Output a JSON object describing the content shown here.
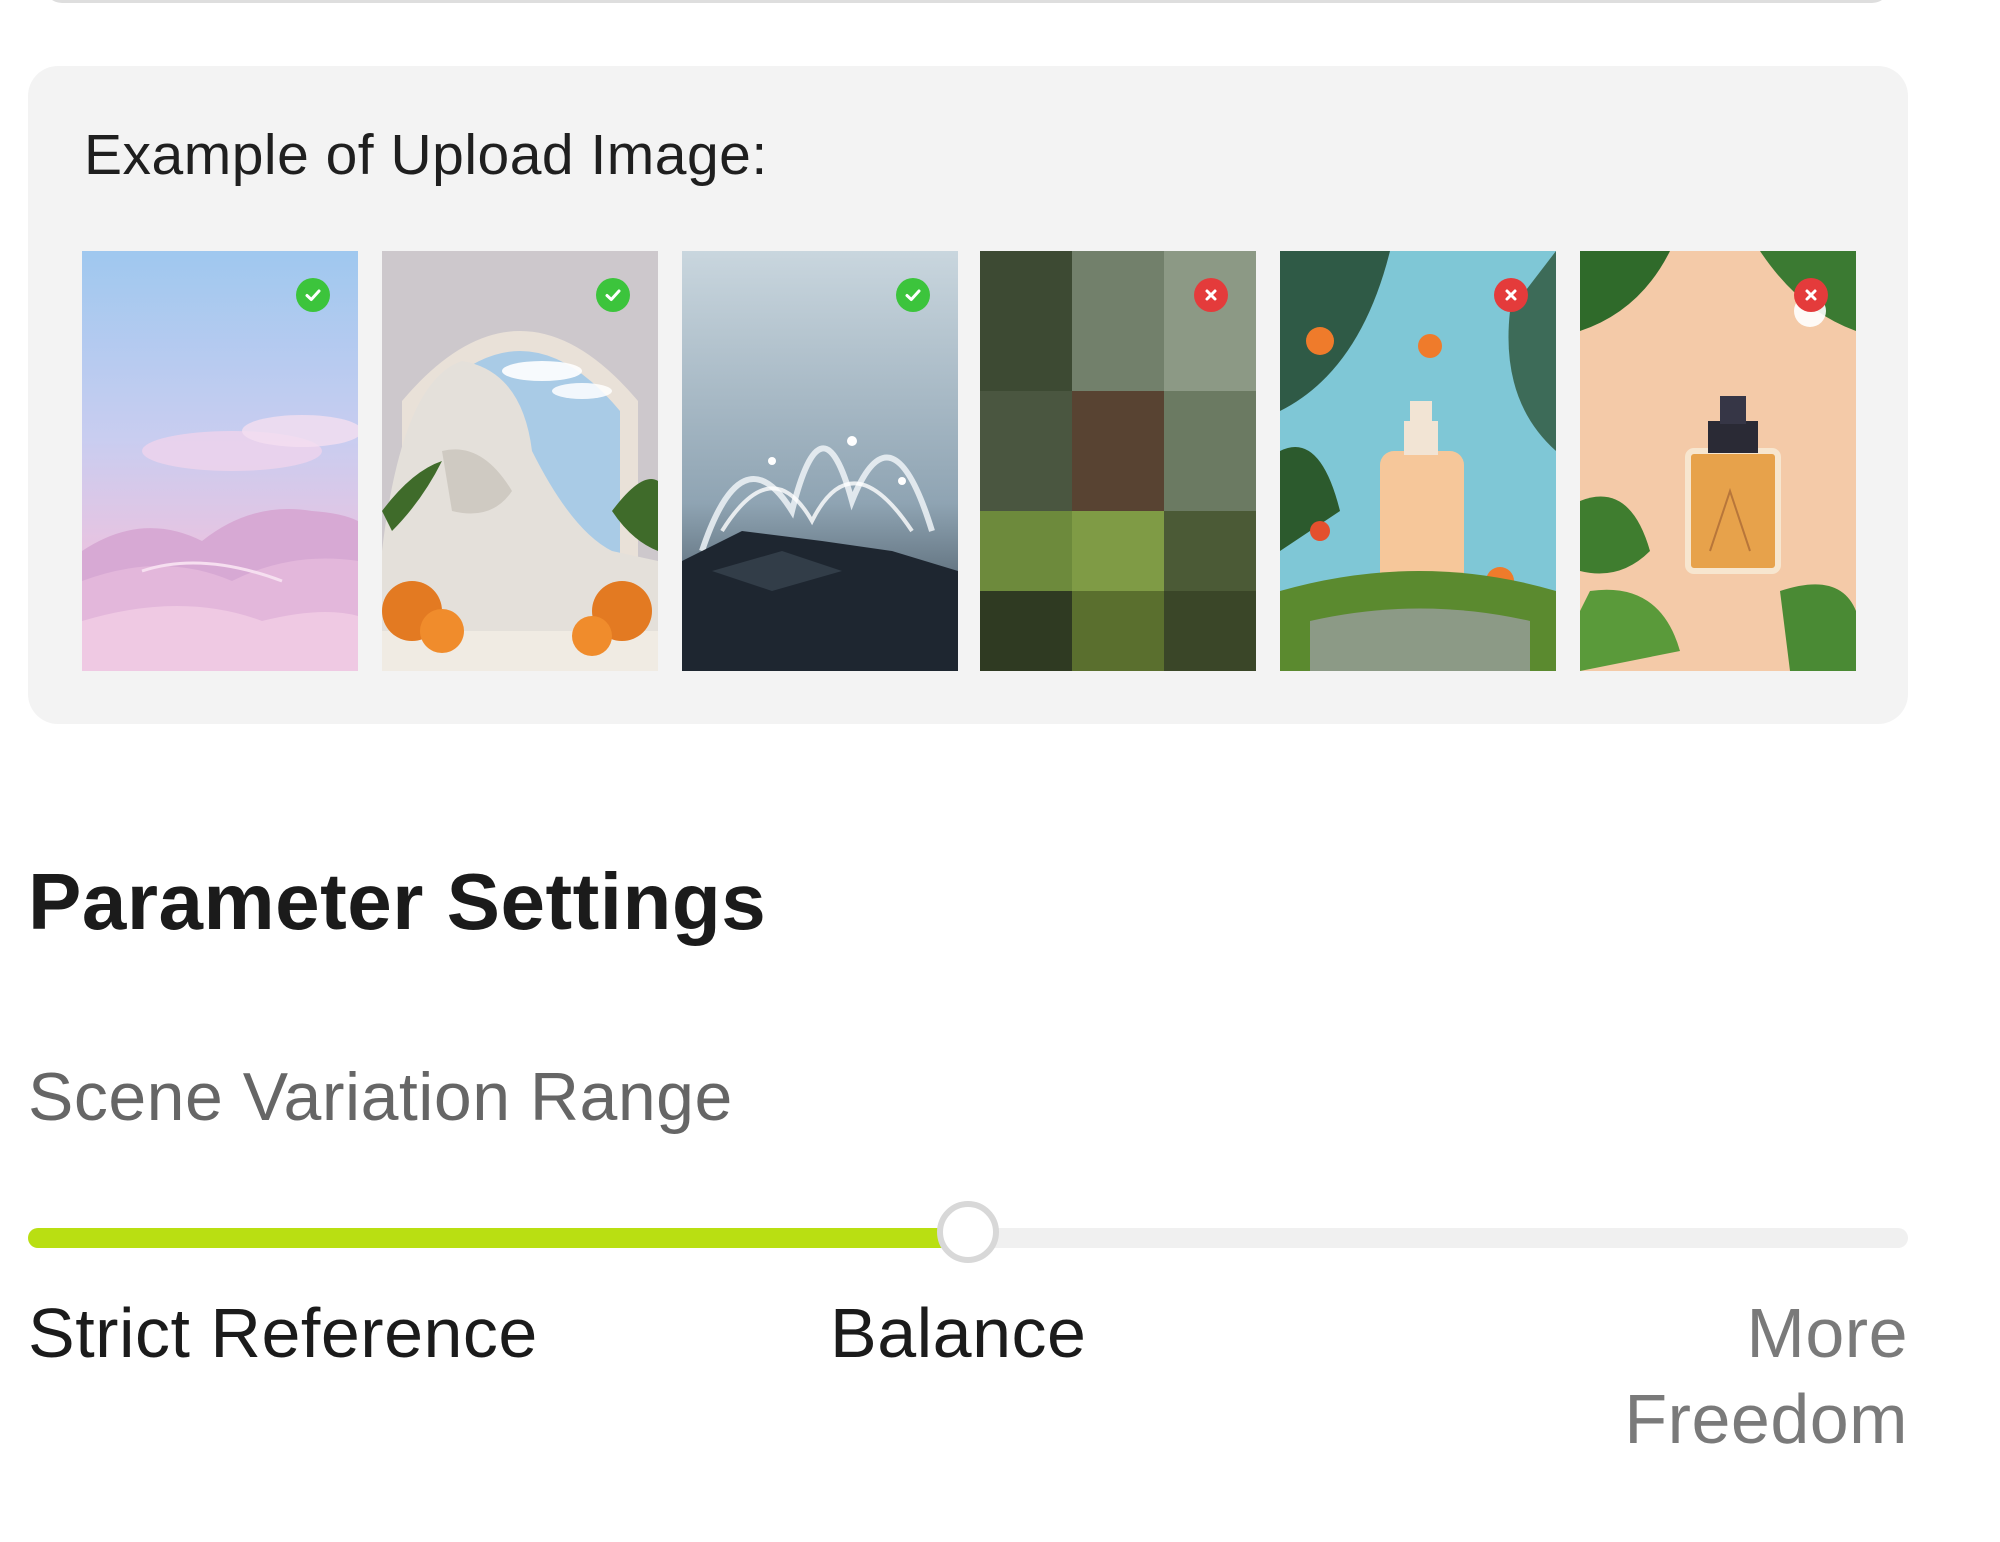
{
  "example": {
    "title": "Example of Upload Image:",
    "images": [
      {
        "subject": "pink desert dunes",
        "status": "accepted",
        "icon": "check-icon"
      },
      {
        "subject": "stone arch with white rock and orange flowers",
        "status": "accepted",
        "icon": "check-icon"
      },
      {
        "subject": "water splash over dark rock",
        "status": "accepted",
        "icon": "check-icon"
      },
      {
        "subject": "pixelated moss and plants",
        "status": "rejected",
        "icon": "cross-icon"
      },
      {
        "subject": "lotion bottle with orange flowers on mossy rock",
        "status": "rejected",
        "icon": "cross-icon"
      },
      {
        "subject": "perfume bottle with green leaves",
        "status": "rejected",
        "icon": "cross-icon"
      }
    ]
  },
  "parameters": {
    "title": "Parameter Settings",
    "scene_variation": {
      "label": "Scene Variation Range",
      "value_fraction": 0.5,
      "marks": {
        "left": "Strict Reference",
        "middle": "Balance",
        "right_line1": "More",
        "right_line2": "Freedom"
      }
    }
  },
  "colors": {
    "accent": "#b9df12",
    "accepted": "#3cc43c",
    "rejected": "#e43b3b"
  }
}
